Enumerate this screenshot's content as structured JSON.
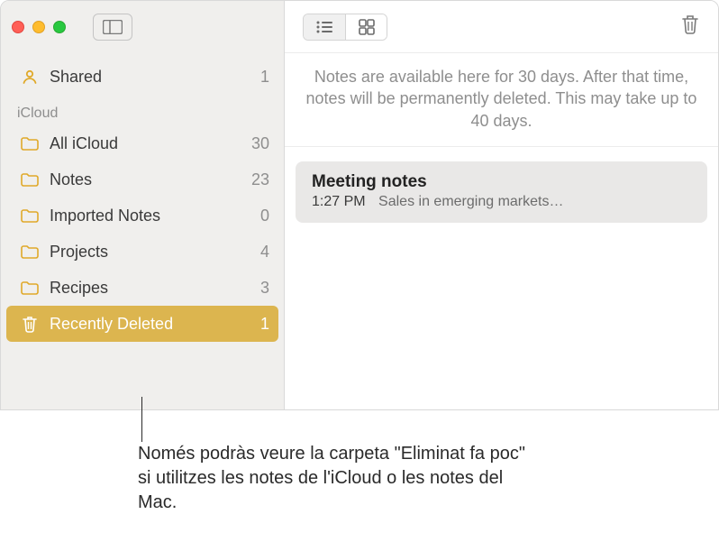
{
  "icons": {
    "shared_color": "#e0a929",
    "folder_color": "#e0a929",
    "trash_color": "#7f7f7f",
    "trash_selected_color": "#ffffff"
  },
  "sidebar": {
    "top": {
      "label": "Shared",
      "count": "1"
    },
    "section_header": "iCloud",
    "folders": [
      {
        "label": "All iCloud",
        "count": "30"
      },
      {
        "label": "Notes",
        "count": "23"
      },
      {
        "label": "Imported Notes",
        "count": "0"
      },
      {
        "label": "Projects",
        "count": "4"
      },
      {
        "label": "Recipes",
        "count": "3"
      }
    ],
    "selected": {
      "label": "Recently Deleted",
      "count": "1"
    }
  },
  "main": {
    "info": "Notes are available here for 30 days. After that time, notes will be permanently deleted. This may take up to 40 days.",
    "note": {
      "title": "Meeting notes",
      "time": "1:27 PM",
      "preview": "Sales in emerging markets…"
    }
  },
  "callout": "Només podràs veure la carpeta \"Eliminat fa poc\" si utilitzes les notes de l'iCloud o les notes del Mac."
}
